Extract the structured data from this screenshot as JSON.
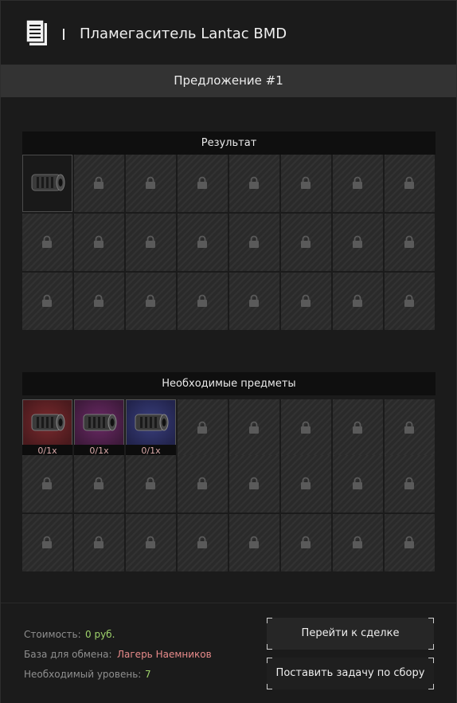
{
  "header": {
    "title": "Пламегаситель Lantac BMD",
    "icon": "document-icon"
  },
  "offer": {
    "label": "Предложение #1"
  },
  "result": {
    "title": "Результат",
    "item": "Пламегаситель Lantac BMD",
    "locked_icon": "lock-icon"
  },
  "required": {
    "title": "Необходимые предметы",
    "items": [
      {
        "count": "0/1x",
        "rarity_color": "#7a2a2e"
      },
      {
        "count": "0/1x",
        "rarity_color": "#6b2a66"
      },
      {
        "count": "0/1x",
        "rarity_color": "#3a3f7d"
      }
    ]
  },
  "info": {
    "cost_label": "Стоимость:",
    "cost_value": "0 руб.",
    "base_label": "База для обмена:",
    "base_value": "Лагерь Наемников",
    "level_label": "Необходимый уровень:",
    "level_value": "7"
  },
  "buttons": {
    "go_to_trade": "Перейти к сделке",
    "set_craft_task": "Поставить задачу по сбору"
  },
  "colors": {
    "accent_green": "#9fd36b",
    "accent_pink": "#e88b8b"
  }
}
